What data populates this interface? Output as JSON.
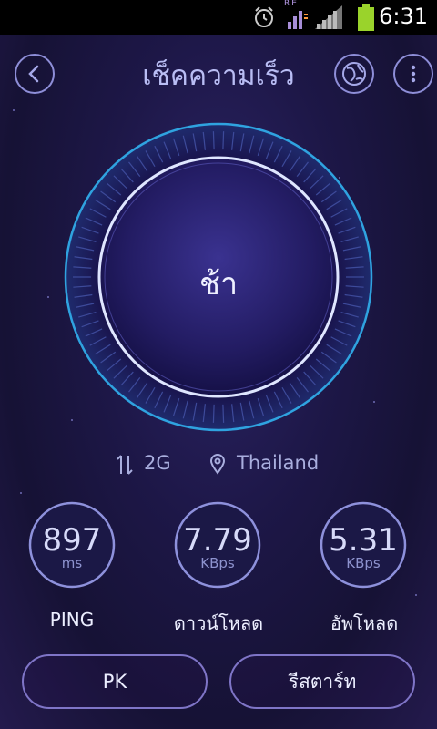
{
  "status_bar": {
    "time": "6:31",
    "signal_label": "RE"
  },
  "header": {
    "title": "เช็คความเร็ว",
    "back_icon": "back-icon",
    "globe_icon": "globe-icon",
    "menu_icon": "overflow-menu-icon"
  },
  "dial": {
    "status": "ช้า"
  },
  "network": {
    "type": "2G",
    "location": "Thailand"
  },
  "metrics": [
    {
      "value": "897",
      "unit": "ms",
      "label": "PING"
    },
    {
      "value": "7.79",
      "unit": "KBps",
      "label": "ดาวน์โหลด"
    },
    {
      "value": "5.31",
      "unit": "KBps",
      "label": "อัพโหลด"
    }
  ],
  "buttons": {
    "pk": "PK",
    "restart": "รีสตาร์ท"
  },
  "colors": {
    "background": "#1d1747",
    "accent": "#8e8ed8",
    "battery": "#9ad32b"
  }
}
